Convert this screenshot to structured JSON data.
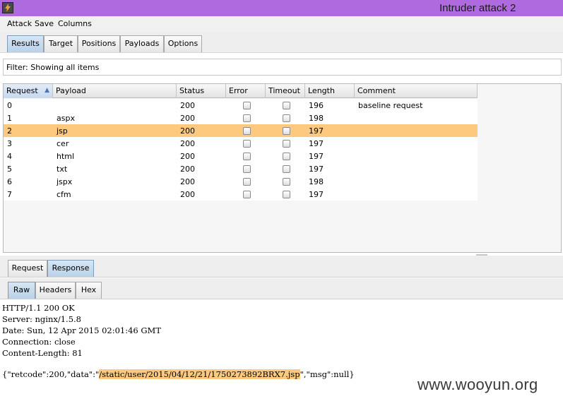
{
  "window": {
    "title": "Intruder attack 2",
    "icon": "burp-lightning-icon"
  },
  "menu": [
    "Attack",
    "Save",
    "Columns"
  ],
  "main_tabs": [
    "Results",
    "Target",
    "Positions",
    "Payloads",
    "Options"
  ],
  "active_main_tab": "Results",
  "filter": {
    "text": "Filter:  Showing all items"
  },
  "table": {
    "columns": [
      "Request",
      "Payload",
      "Status",
      "Error",
      "Timeout",
      "Length",
      "Comment"
    ],
    "sorted_column": "Request",
    "sort_direction": "▲",
    "selected_row_index": 2,
    "rows": [
      {
        "request": "0",
        "payload": "",
        "status": "200",
        "error": false,
        "timeout": false,
        "length": "196",
        "comment": "baseline request"
      },
      {
        "request": "1",
        "payload": "aspx",
        "status": "200",
        "error": false,
        "timeout": false,
        "length": "198",
        "comment": ""
      },
      {
        "request": "2",
        "payload": "jsp",
        "status": "200",
        "error": false,
        "timeout": false,
        "length": "197",
        "comment": ""
      },
      {
        "request": "3",
        "payload": "cer",
        "status": "200",
        "error": false,
        "timeout": false,
        "length": "197",
        "comment": ""
      },
      {
        "request": "4",
        "payload": "html",
        "status": "200",
        "error": false,
        "timeout": false,
        "length": "197",
        "comment": ""
      },
      {
        "request": "5",
        "payload": "txt",
        "status": "200",
        "error": false,
        "timeout": false,
        "length": "197",
        "comment": ""
      },
      {
        "request": "6",
        "payload": "jspx",
        "status": "200",
        "error": false,
        "timeout": false,
        "length": "198",
        "comment": ""
      },
      {
        "request": "7",
        "payload": "cfm",
        "status": "200",
        "error": false,
        "timeout": false,
        "length": "197",
        "comment": ""
      }
    ]
  },
  "message_tabs": [
    "Request",
    "Response"
  ],
  "active_message_tab": "Response",
  "view_tabs": [
    "Raw",
    "Headers",
    "Hex"
  ],
  "active_view_tab": "Raw",
  "response": {
    "lines": [
      "HTTP/1.1 200 OK",
      "Server: nginx/1.5.8",
      "Date: Sun, 12 Apr 2015 02:01:46 GMT",
      "Connection: close",
      "Content-Length: 81"
    ],
    "body_prefix": "{\"retcode\":200,\"data\":\"",
    "body_highlight": "/static/user/2015/04/12/21/1750273892BRX7.jsp",
    "body_suffix": "\",\"msg\":null}"
  },
  "watermark": "www.wooyun.org",
  "colors": {
    "titlebar": "#b06adf",
    "selection": "#fcc97f",
    "active_tab": "#b9d1e8"
  }
}
